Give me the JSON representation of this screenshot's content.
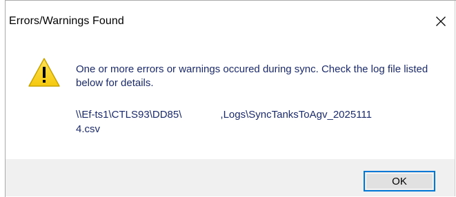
{
  "dialog": {
    "title": "Errors/Warnings Found",
    "icon": "warning-icon",
    "message": "One or more errors or warnings occured during sync. Check the log file listed below for details.",
    "path_part1": "\\\\Ef-ts1\\CTLS93\\DD85\\",
    "path_part2": ",Logs\\SyncTanksToAgv_2025111",
    "path_part3": "4.csv",
    "ok_label": "OK",
    "colors": {
      "icon_fill": "#f9d71c",
      "icon_stroke": "#c8a400",
      "message_text": "#1b2a6b",
      "footer_bg": "#f0f0f0",
      "button_focus": "#0078d7"
    }
  }
}
